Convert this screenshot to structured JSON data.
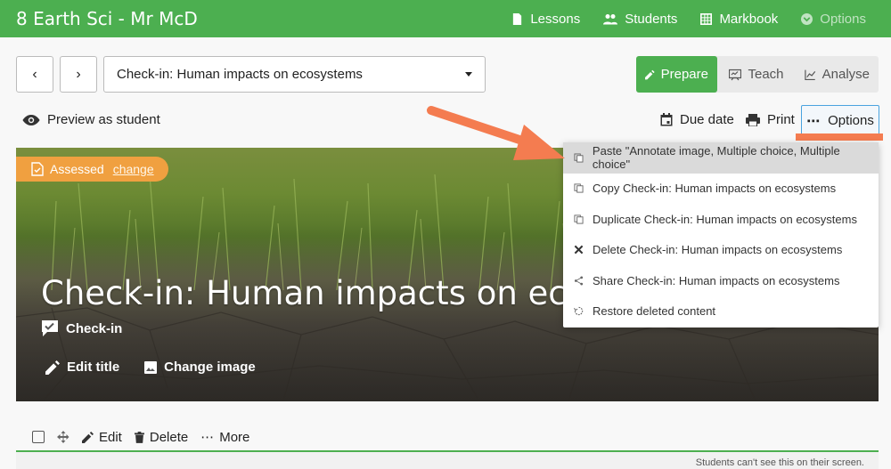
{
  "header": {
    "title": "8 Earth Sci - Mr McD",
    "nav": [
      {
        "label": "Lessons",
        "icon": "document-icon"
      },
      {
        "label": "Students",
        "icon": "people-icon"
      },
      {
        "label": "Markbook",
        "icon": "grid-icon"
      },
      {
        "label": "Options",
        "icon": "chevron-circle-icon"
      }
    ]
  },
  "selector": {
    "value": "Check-in: Human impacts on ecosystems"
  },
  "modes": [
    {
      "label": "Prepare",
      "active": true
    },
    {
      "label": "Teach",
      "active": false
    },
    {
      "label": "Analyse",
      "active": false
    }
  ],
  "toolbar": {
    "preview": "Preview as student",
    "due_date": "Due date",
    "print": "Print",
    "options": "Options"
  },
  "hero": {
    "badge": "Assessed",
    "badge_link": "change",
    "title": "Check-in: Human impacts on ecosystems",
    "type": "Check-in",
    "edit_title": "Edit title",
    "change_image": "Change image"
  },
  "menu": [
    {
      "label": "Paste \"Annotate image, Multiple choice, Multiple choice\"",
      "icon": "paste-icon",
      "highlighted": true
    },
    {
      "label": "Copy Check-in: Human impacts on ecosystems",
      "icon": "copy-icon",
      "highlighted": false
    },
    {
      "label": "Duplicate Check-in: Human impacts on ecosystems",
      "icon": "duplicate-icon",
      "highlighted": false
    },
    {
      "label": "Delete Check-in: Human impacts on ecosystems",
      "icon": "x-icon",
      "highlighted": false
    },
    {
      "label": "Share Check-in: Human impacts on ecosystems",
      "icon": "share-icon",
      "highlighted": false
    },
    {
      "label": "Restore deleted content",
      "icon": "restore-icon",
      "highlighted": false
    }
  ],
  "item_bar": {
    "edit": "Edit",
    "delete": "Delete",
    "more": "More"
  },
  "footer_note": "Students can't see this on their screen.",
  "colors": {
    "brand_green": "#4caf50",
    "accent_orange": "#f47c50",
    "badge_orange": "#f0a040"
  }
}
